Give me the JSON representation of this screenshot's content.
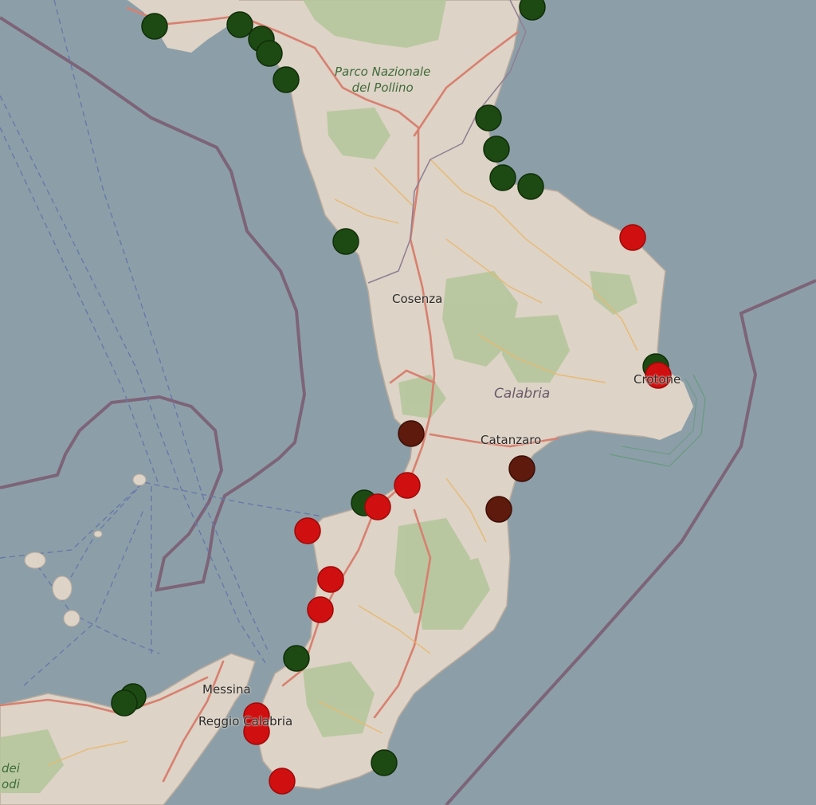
{
  "map": {
    "labels": {
      "park_line1": "Parco Nazionale",
      "park_line2": "del Pollino",
      "cosenza": "Cosenza",
      "calabria": "Calabria",
      "catanzaro": "Catanzaro",
      "crotone": "Crotone",
      "messina": "Messina",
      "reggio": "Reggio Calabria",
      "edge_line1": "dei",
      "edge_line2": "odi"
    },
    "colors": {
      "sea": "#8c9fa8",
      "land": "#ddd3c6",
      "forest": "#b3c59a",
      "road": "#d88070",
      "boundary": "#7d6478",
      "marker_green": "#1d4a12",
      "marker_red": "#d01010",
      "marker_brown": "#5e1a0c"
    },
    "marker_legend": [
      "green",
      "red",
      "brown"
    ]
  }
}
